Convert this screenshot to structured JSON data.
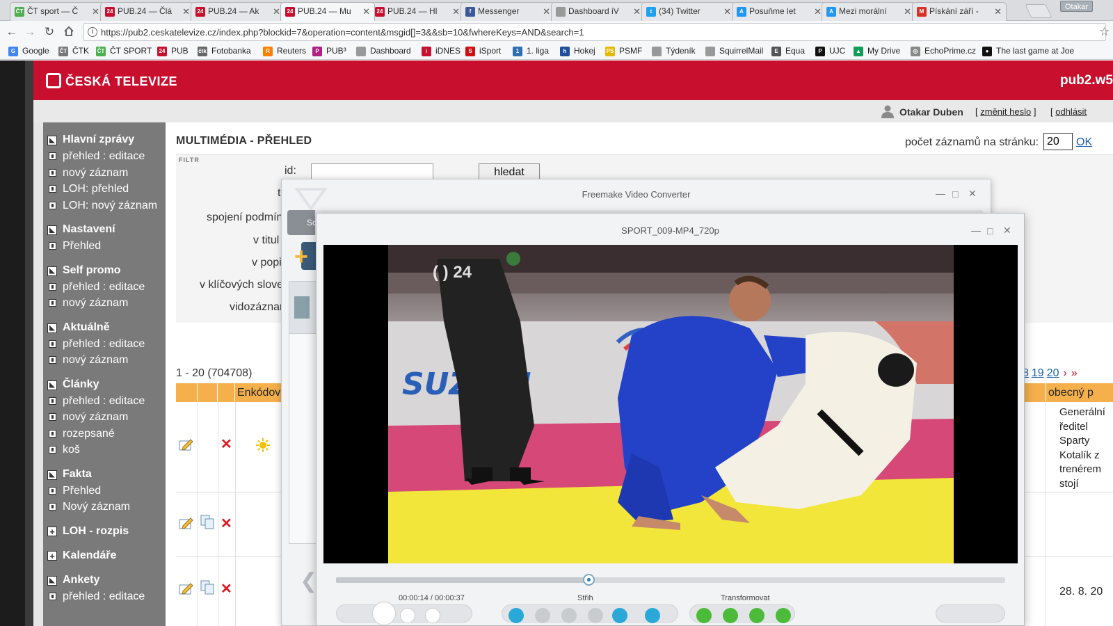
{
  "browser": {
    "tabs": [
      {
        "title": "ČT sport — Č",
        "icon_color": "#4caf50",
        "icon_text": "ČT"
      },
      {
        "title": "PUB.24 — Člá",
        "icon_color": "#c8102e",
        "icon_text": "24"
      },
      {
        "title": "PUB.24 — Ak",
        "icon_color": "#c8102e",
        "icon_text": "24"
      },
      {
        "title": "PUB.24 — Mu",
        "icon_color": "#c8102e",
        "icon_text": "24",
        "active": true
      },
      {
        "title": "PUB.24 — Hl",
        "icon_color": "#c8102e",
        "icon_text": "24"
      },
      {
        "title": "Messenger",
        "icon_color": "#3b5998",
        "icon_text": "f"
      },
      {
        "title": "Dashboard iV",
        "icon_color": "#999999",
        "icon_text": ""
      },
      {
        "title": "(34) Twitter",
        "icon_color": "#1da1f2",
        "icon_text": "t"
      },
      {
        "title": "Posuňme let",
        "icon_color": "#2196f3",
        "icon_text": "A"
      },
      {
        "title": "Mezi morální",
        "icon_color": "#2196f3",
        "icon_text": "A"
      },
      {
        "title": "Pískání září -",
        "icon_color": "#d93025",
        "icon_text": "M"
      }
    ],
    "profile_name": "Otakar",
    "url": "https://pub2.ceskatelevize.cz/index.php?blockid=7&operation=content&msgid[]=3&&sb=10&fwhereKeys=AND&search=1",
    "bookmarks": [
      {
        "label": "Google",
        "icon_color": "#4285f4",
        "icon_text": "G"
      },
      {
        "label": "ČTK",
        "icon_color": "#777777",
        "icon_text": "ČT"
      },
      {
        "label": "ČT SPORT",
        "icon_color": "#4caf50",
        "icon_text": "ČT"
      },
      {
        "label": "PUB",
        "icon_color": "#c8102e",
        "icon_text": "24"
      },
      {
        "label": "Fotobanka",
        "icon_color": "#666666",
        "icon_text": "čtk"
      },
      {
        "label": "Reuters",
        "icon_color": "#ff8000",
        "icon_text": "R"
      },
      {
        "label": "PUB³",
        "icon_color": "#b0207f",
        "icon_text": "P"
      },
      {
        "label": "Dashboard",
        "icon_color": "#999999",
        "icon_text": ""
      },
      {
        "label": "iDNES",
        "icon_color": "#c8102e",
        "icon_text": "i"
      },
      {
        "label": "iSport",
        "icon_color": "#d01010",
        "icon_text": "S"
      },
      {
        "label": "1. liga",
        "icon_color": "#2e6fb5",
        "icon_text": "1"
      },
      {
        "label": "Hokej",
        "icon_color": "#1f4f9a",
        "icon_text": "h"
      },
      {
        "label": "PSMF",
        "icon_color": "#e6b800",
        "icon_text": "PS"
      },
      {
        "label": "Týdeník",
        "icon_color": "#999999",
        "icon_text": ""
      },
      {
        "label": "SquirrelMail",
        "icon_color": "#999999",
        "icon_text": ""
      },
      {
        "label": "Equa",
        "icon_color": "#555555",
        "icon_text": "E"
      },
      {
        "label": "UJC",
        "icon_color": "#111111",
        "icon_text": "P"
      },
      {
        "label": "My Drive",
        "icon_color": "#0f9d58",
        "icon_text": "▲"
      },
      {
        "label": "EchoPrime.cz",
        "icon_color": "#888888",
        "icon_text": "◎"
      },
      {
        "label": "The last game at Joe",
        "icon_color": "#111111",
        "icon_text": "●"
      }
    ]
  },
  "site": {
    "logo_text": "ČESKÁ TELEVIZE",
    "server_name": "pub2.w5",
    "user": {
      "name": "Otakar Duben",
      "change_password": "změnit heslo",
      "logout": "odhlásit"
    }
  },
  "sidebar": [
    {
      "title": "Hlavní zprávy",
      "type": "open",
      "items": [
        "přehled : editace",
        "nový záznam",
        "LOH: přehled",
        "LOH: nový záznam"
      ]
    },
    {
      "title": "Nastavení",
      "type": "open",
      "items": [
        "Přehled"
      ]
    },
    {
      "title": "Self promo",
      "type": "open",
      "items": [
        "přehled : editace",
        "nový záznam"
      ]
    },
    {
      "title": "Aktuálně",
      "type": "open",
      "items": [
        "přehled : editace",
        "nový záznam"
      ]
    },
    {
      "title": "Články",
      "type": "open",
      "items": [
        "přehled : editace",
        "nový záznam",
        "rozepsané",
        "koš"
      ]
    },
    {
      "title": "Fakta",
      "type": "open",
      "items": [
        "Přehled",
        "Nový záznam"
      ]
    },
    {
      "title": "LOH - rozpis",
      "type": "closed",
      "items": []
    },
    {
      "title": "Kalendáře",
      "type": "closed",
      "items": []
    },
    {
      "title": "Ankety",
      "type": "open",
      "items": [
        "přehled : editace"
      ]
    }
  ],
  "main": {
    "title": "MULTIMÉDIA - PŘEHLED",
    "per_page_label": "počet záznamů na stránku:",
    "per_page_value": "20",
    "ok_label": "OK",
    "filter": {
      "tag": "FILTR",
      "id_label": "id:",
      "search_button": "hledat",
      "labels": [
        "t",
        "spojení podmín",
        "v titul",
        "v popi",
        "v klíčových slove",
        "vidozáznar"
      ]
    },
    "records_summary": "1 - 20 (704708)",
    "pager": {
      "pages": [
        "8",
        "19",
        "20"
      ],
      "next": "›",
      "last": "»"
    },
    "columns": {
      "encoding": "Enkódová",
      "common": "obecný p"
    },
    "rows": [
      {
        "desc_lines": [
          "Generální",
          "ředitel",
          "Sparty",
          "Kotalík z",
          "trenérem",
          "stojí"
        ]
      },
      {
        "desc_lines": []
      },
      {
        "desc_lines": [
          "28. 8. 20"
        ]
      }
    ]
  },
  "freemake_back": {
    "title": "Freemake Video Converter",
    "tab_label": "Sc"
  },
  "freemake_player": {
    "title": "SPORT_009-MP4_720p",
    "channel_logo": "24",
    "sponsor_text": "SUZUKI",
    "time": "00:00:14 / 00:00:37",
    "progress": 0.378,
    "cut_label": "Střih",
    "transform_label": "Transformovat"
  }
}
